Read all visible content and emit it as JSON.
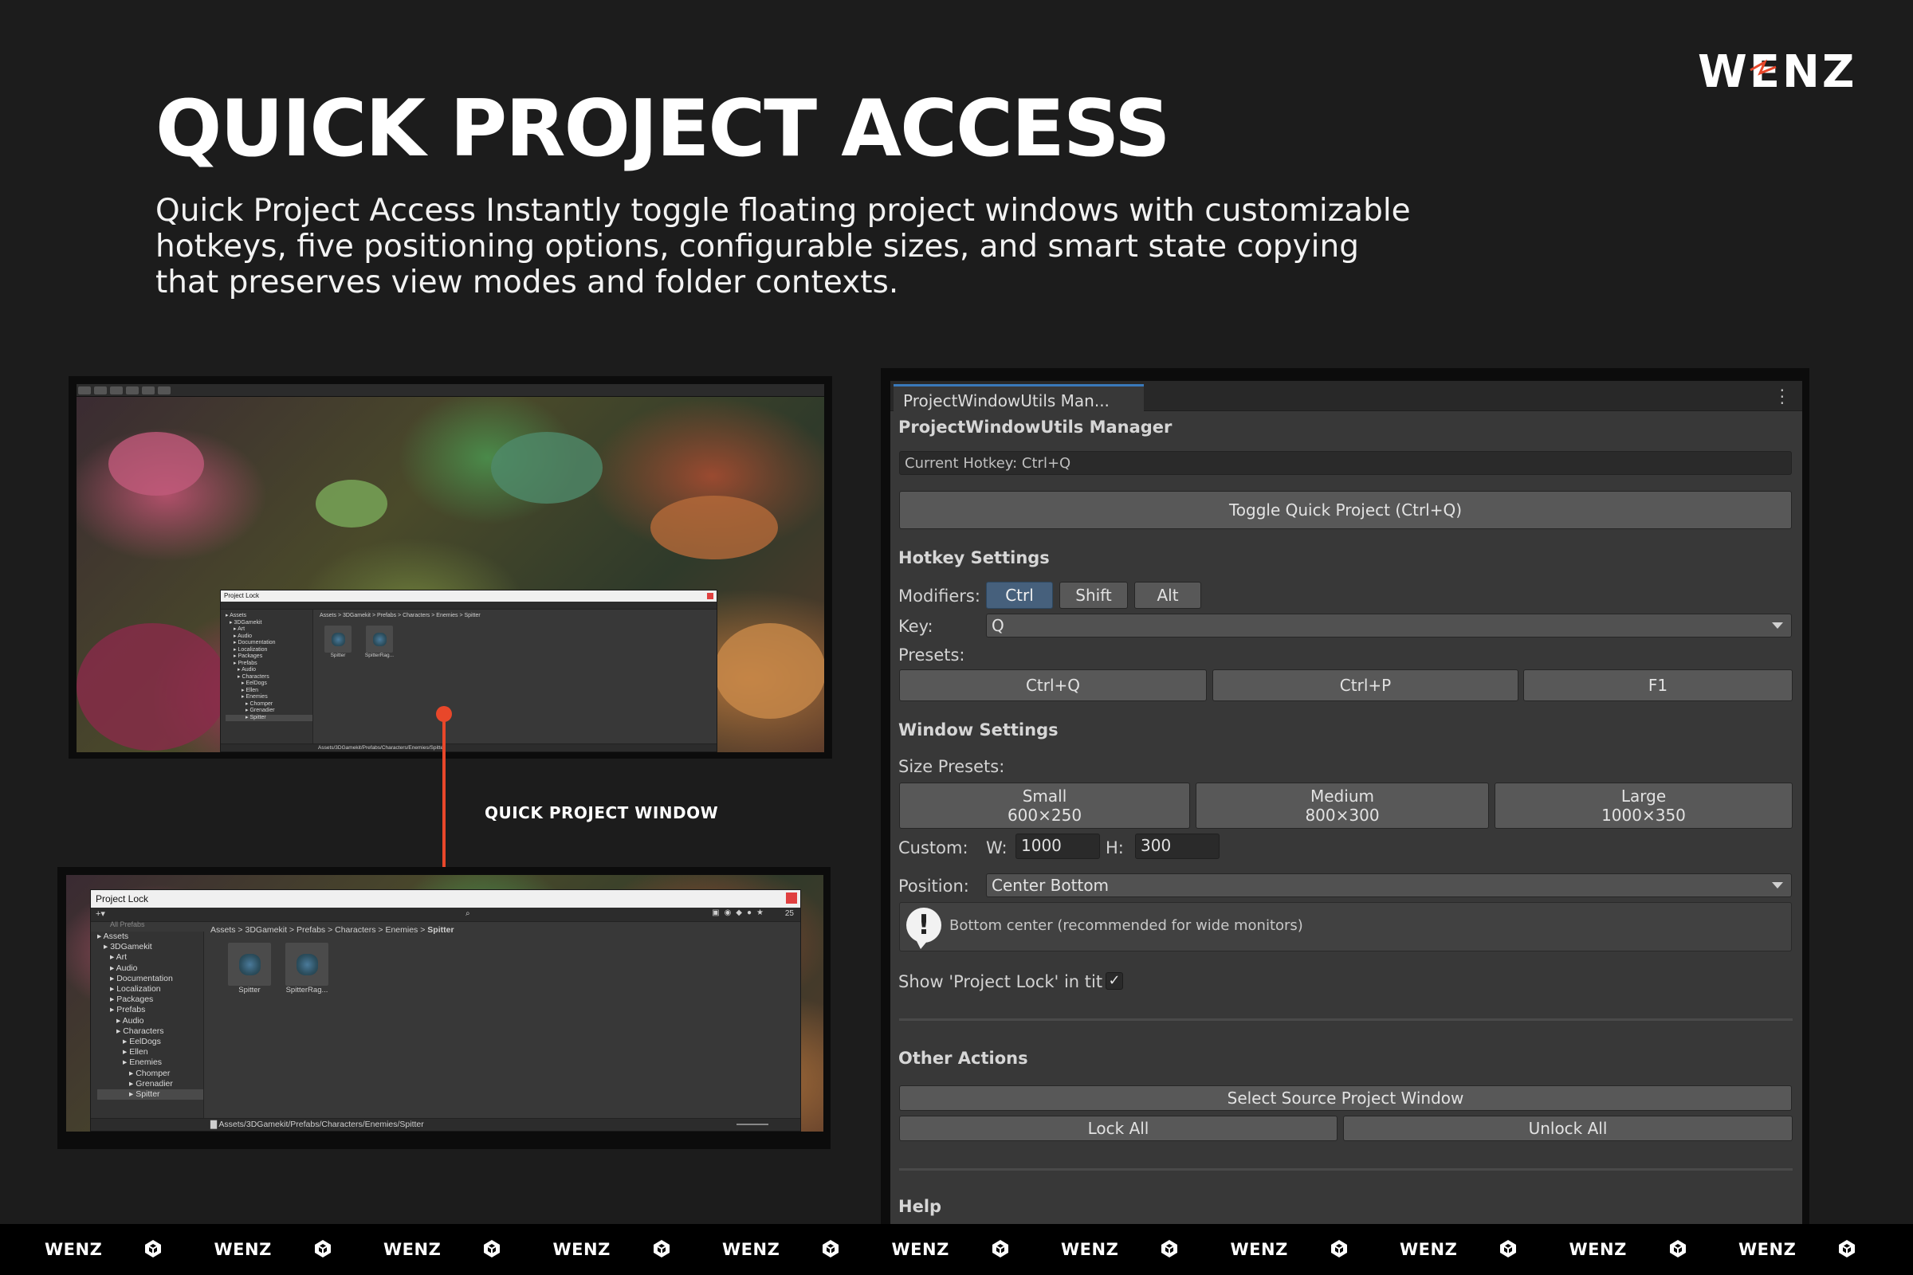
{
  "brand": {
    "logo_text": "WENZ"
  },
  "page": {
    "title": "QUICK PROJECT ACCESS",
    "description": "Quick Project Access Instantly toggle floating project windows with customizable hotkeys, five positioning options, configurable sizes, and smart state copying that preserves view modes and folder contexts."
  },
  "callout": {
    "label": "QUICK PROJECT WINDOW"
  },
  "screenshot_small": {
    "window_title": "Project Lock",
    "breadcrumb": "Assets > 3DGamekit > Prefabs > Characters > Enemies > Spitter",
    "tree": [
      "Assets",
      "3DGamekit",
      "Art",
      "Audio",
      "Documentation",
      "Localization",
      "Packages",
      "Prefabs",
      "Audio",
      "Characters",
      "EelDogs",
      "Ellen",
      "Enemies",
      "Chomper",
      "Grenadier",
      "Spitter"
    ],
    "assets": [
      "Spitter",
      "SpitterRag..."
    ],
    "status_path": "Assets/3DGamekit/Prefabs/Characters/Enemies/Spitter"
  },
  "screenshot_large": {
    "window_title": "Project Lock",
    "search_hint": "All Prefabs",
    "count": "25",
    "breadcrumb": [
      "Assets",
      "3DGamekit",
      "Prefabs",
      "Characters",
      "Enemies",
      "Spitter"
    ],
    "tree": [
      "Assets",
      "3DGamekit",
      "Art",
      "Audio",
      "Documentation",
      "Localization",
      "Packages",
      "Prefabs",
      "Audio",
      "Characters",
      "EelDogs",
      "Ellen",
      "Enemies",
      "Chomper",
      "Grenadier",
      "Spitter"
    ],
    "assets": [
      "Spitter",
      "SpitterRag..."
    ],
    "status_path": "Assets/3DGamekit/Prefabs/Characters/Enemies/Spitter"
  },
  "editor": {
    "tab_label": "ProjectWindowUtils Man...",
    "header": "ProjectWindowUtils Manager",
    "current_hotkey": "Current Hotkey: Ctrl+Q",
    "toggle_button": "Toggle Quick Project (Ctrl+Q)",
    "hotkey_settings": {
      "heading": "Hotkey Settings",
      "modifiers_label": "Modifiers:",
      "modifiers": [
        "Ctrl",
        "Shift",
        "Alt"
      ],
      "active_modifier": "Ctrl",
      "key_label": "Key:",
      "key_value": "Q",
      "presets_label": "Presets:",
      "presets": [
        "Ctrl+Q",
        "Ctrl+P",
        "F1"
      ]
    },
    "window_settings": {
      "heading": "Window Settings",
      "size_presets_label": "Size Presets:",
      "sizes": [
        {
          "name": "Small",
          "dims": "600×250"
        },
        {
          "name": "Medium",
          "dims": "800×300"
        },
        {
          "name": "Large",
          "dims": "1000×350"
        }
      ],
      "custom_label": "Custom:",
      "width_label": "W:",
      "width_value": "1000",
      "height_label": "H:",
      "height_value": "300",
      "position_label": "Position:",
      "position_value": "Center Bottom",
      "position_help": "Bottom center (recommended for wide monitors)",
      "show_title_label": "Show 'Project Lock' in title",
      "show_title_checked": true
    },
    "other_actions": {
      "heading": "Other Actions",
      "select_source": "Select Source Project Window",
      "lock_all": "Lock All",
      "unlock_all": "Unlock All"
    },
    "help_heading": "Help"
  },
  "footer": {
    "items": [
      "WENZ",
      "WENZ",
      "WENZ",
      "WENZ",
      "WENZ",
      "WENZ",
      "WENZ",
      "WENZ",
      "WENZ",
      "WENZ",
      "WENZ"
    ],
    "icon": "unity-logo-icon"
  },
  "colors": {
    "background": "#1c1c1c",
    "accent_arrow": "#e8472a",
    "editor_bg": "#383838",
    "active_tab": "#3a79bb",
    "active_button": "#46607c"
  }
}
